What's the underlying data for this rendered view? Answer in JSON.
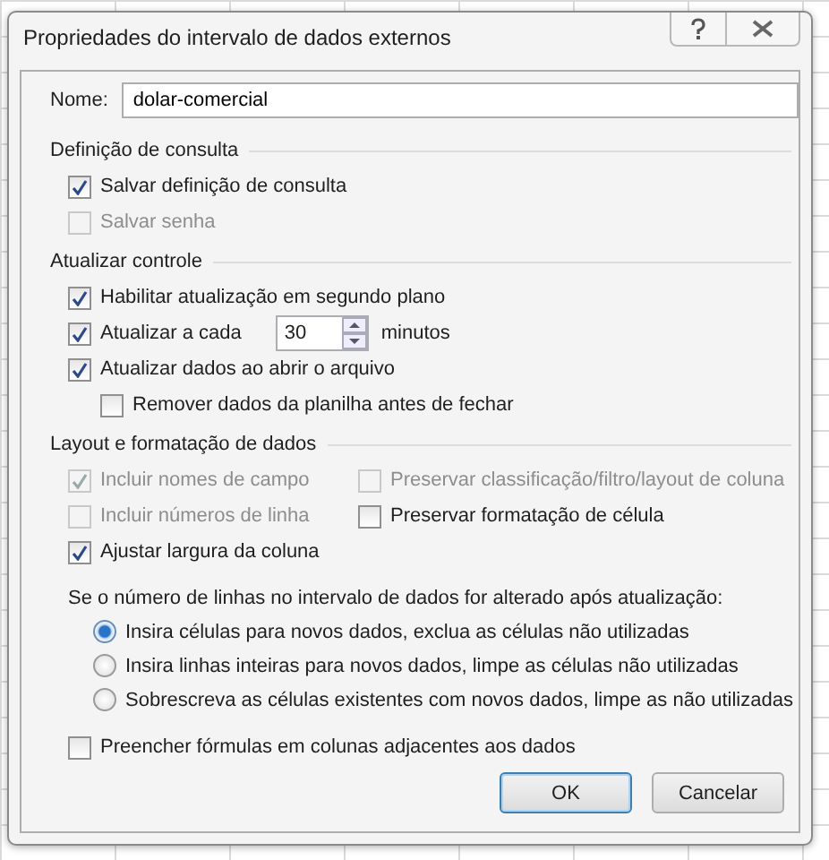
{
  "window": {
    "title": "Propriedades do intervalo de dados externos"
  },
  "name_field": {
    "label": "Nome:",
    "value": "dolar-comercial"
  },
  "sections": [
    {
      "title": "Definição de consulta",
      "rows": [
        [
          {
            "kind": "checkbox",
            "label": "Salvar definição de consulta",
            "checked": true,
            "disabled": false
          }
        ],
        [
          {
            "kind": "checkbox",
            "label": "Salvar senha",
            "checked": false,
            "disabled": true
          }
        ]
      ]
    },
    {
      "title": "Atualizar controle",
      "rows": [
        [
          {
            "kind": "checkbox",
            "label": "Habilitar atualização em segundo plano",
            "checked": true,
            "disabled": false
          }
        ],
        [
          {
            "kind": "spin",
            "label": "Atualizar a cada",
            "checked": true,
            "disabled": false,
            "value": "30",
            "unit": "minutos"
          }
        ],
        [
          {
            "kind": "checkbox",
            "label": "Atualizar dados ao abrir o arquivo",
            "checked": true,
            "disabled": false,
            "children": [
              {
                "kind": "checkbox",
                "label": "Remover dados da planilha antes de fechar",
                "checked": false,
                "disabled": false
              }
            ]
          }
        ]
      ]
    },
    {
      "title": "Layout e formatação de dados",
      "rows": [
        [
          {
            "kind": "checkbox",
            "label": "Incluir nomes de campo",
            "checked": true,
            "disabled": true
          },
          {
            "kind": "checkbox",
            "label": "Preservar classificação/filtro/layout de coluna",
            "checked": false,
            "disabled": true
          }
        ],
        [
          {
            "kind": "checkbox",
            "label": "Incluir números de linha",
            "checked": false,
            "disabled": true
          },
          {
            "kind": "checkbox",
            "label": "Preservar formatação de célula",
            "checked": false,
            "disabled": false
          }
        ],
        [
          {
            "kind": "checkbox",
            "label": "Ajustar largura da coluna",
            "checked": true,
            "disabled": false
          }
        ]
      ]
    }
  ],
  "row_change": {
    "question": "Se o número de linhas no intervalo de dados for alterado após atualização:",
    "options": [
      {
        "label": "Insira células para novos dados, exclua as células não utilizadas",
        "selected": true
      },
      {
        "label": "Insira linhas inteiras para novos dados, limpe as células não utilizadas",
        "selected": false
      },
      {
        "label": "Sobrescreva as células existentes com novos dados, limpe as não utilizadas",
        "selected": false
      }
    ]
  },
  "fill_formulas": {
    "label": "Preencher fórmulas em colunas adjacentes aos dados",
    "checked": false,
    "disabled": false
  },
  "buttons": [
    {
      "label": "OK",
      "default": true
    },
    {
      "label": "Cancelar",
      "default": false
    }
  ]
}
